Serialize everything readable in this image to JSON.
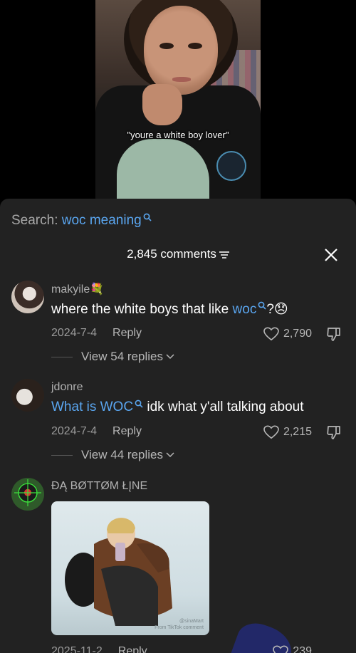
{
  "video": {
    "caption": "\"youre a white boy lover\""
  },
  "search": {
    "prefix": "Search:",
    "term": "woc meaning",
    "icon": "search-icon"
  },
  "header": {
    "count": "2,845 comments",
    "filter_icon": "filter-icon",
    "close_icon": "close-icon"
  },
  "colors": {
    "link": "#5aa6f0",
    "sheet_bg": "#222222",
    "muted": "#9a9a9a"
  },
  "comments": [
    {
      "username": "makyile💐",
      "text_before": "where the white boys that like ",
      "text_link": "woc",
      "text_after": "?😞",
      "date": "2024-7-4",
      "reply": "Reply",
      "likes": "2,790",
      "view_replies": "View 54 replies"
    },
    {
      "username": "jdonre",
      "text_before": "",
      "text_link": "What is WOC",
      "text_after": " idk what y'all talking about",
      "date": "2024-7-4",
      "reply": "Reply",
      "likes": "2,215",
      "view_replies": "View 44 replies"
    },
    {
      "username": "ĐĄ BØTTØM ŁĮNE",
      "media_watermark_line1": "@sinaMart",
      "media_watermark_line2": "From TikTok comment",
      "date": "2025-11-2",
      "reply": "Reply",
      "likes": "239"
    }
  ]
}
